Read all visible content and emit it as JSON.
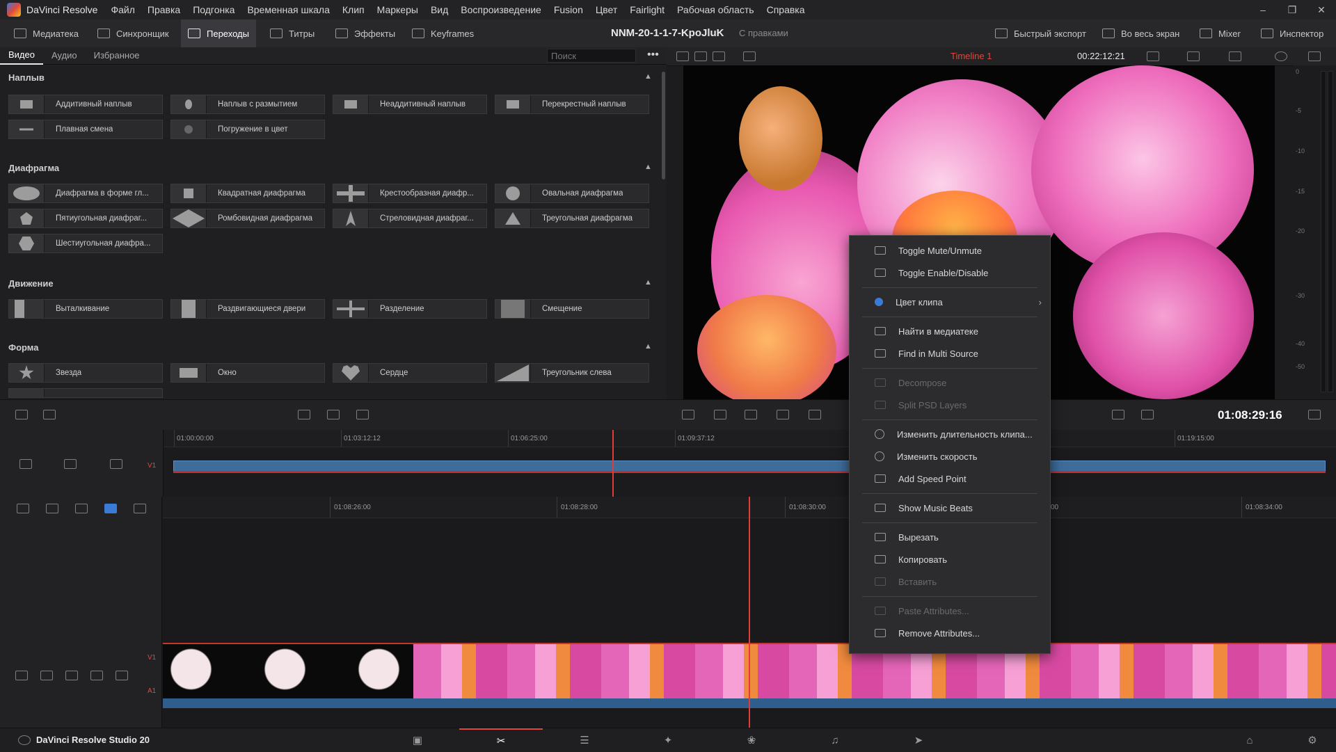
{
  "menubar": {
    "app": "DaVinci Resolve",
    "items": [
      "Файл",
      "Правка",
      "Подгонка",
      "Временная шкала",
      "Клип",
      "Маркеры",
      "Вид",
      "Воспроизведение",
      "Fusion",
      "Цвет",
      "Fairlight",
      "Рабочая область",
      "Справка"
    ]
  },
  "toolbar": {
    "media": "Медиатека",
    "sync": "Синхронщик",
    "transitions": "Переходы",
    "titles": "Титры",
    "effects": "Эффекты",
    "keyframes": "Keyframes",
    "project": "NNM-20-1-1-7-KpoJluK",
    "edited": "С правками",
    "quick_export": "Быстрый экспорт",
    "fullscreen": "Во весь экран",
    "mixer": "Mixer",
    "inspector": "Инспектор"
  },
  "fx_tabs": [
    "Видео",
    "Аудио",
    "Избранное"
  ],
  "fx_search_placeholder": "Поиск",
  "sections": {
    "dissolve": {
      "title": "Наплыв",
      "items": [
        "Аддитивный наплыв",
        "Наплыв с размытием",
        "Неаддитивный наплыв",
        "Перекрестный наплыв",
        "Плавная смена",
        "Погружение в цвет"
      ]
    },
    "iris": {
      "title": "Диафрагма",
      "items": [
        "Диафрагма в форме гл...",
        "Квадратная диафрагма",
        "Крестообразная диафр...",
        "Овальная диафрагма",
        "Пятиугольная диафраг...",
        "Ромбовидная диафрагма",
        "Стреловидная диафраг...",
        "Треугольная диафрагма",
        "Шестиугольная диафра..."
      ]
    },
    "motion": {
      "title": "Движение",
      "items": [
        "Выталкивание",
        "Раздвигающиеся двери",
        "Разделение",
        "Смещение"
      ]
    },
    "shape": {
      "title": "Форма",
      "items": [
        "Звезда",
        "Окно",
        "Сердце",
        "Треугольник слева"
      ]
    }
  },
  "viewer": {
    "timeline_name": "Timeline 1",
    "timecode": "00:22:12:21"
  },
  "meter_scale": [
    "0",
    "-5",
    "-10",
    "-15",
    "-20",
    "-30",
    "-40",
    "-50"
  ],
  "playhead_timecode": "01:08:29:16",
  "upper_ruler": [
    "01:00:00:00",
    "01:03:12:12",
    "01:06:25:00",
    "01:09:37:12",
    "01:19:15:00"
  ],
  "lower_ruler": [
    "01:08:26:00",
    "01:08:28:00",
    "01:08:30:00",
    "00",
    "01:08:34:00"
  ],
  "tracks": {
    "v1": "V1",
    "a1": "A1"
  },
  "context_menu": {
    "items": [
      {
        "label": "Toggle Mute/Unmute",
        "icon": "speaker-icon",
        "disabled": false
      },
      {
        "label": "Toggle Enable/Disable",
        "icon": "checkbox-icon",
        "disabled": false
      },
      {
        "label": "Цвет клипа",
        "icon": "color-dot-icon",
        "disabled": false
      },
      {
        "label": "Найти в медиатеке",
        "icon": "find-icon",
        "disabled": false
      },
      {
        "label": "Find in Multi Source",
        "icon": "find-multi-icon",
        "disabled": false
      },
      {
        "label": "Decompose",
        "icon": "decompose-icon",
        "disabled": true
      },
      {
        "label": "Split PSD Layers",
        "icon": "psd-icon",
        "disabled": true
      },
      {
        "label": "Изменить длительность клипа...",
        "icon": "duration-icon",
        "disabled": false
      },
      {
        "label": "Изменить скорость",
        "icon": "speed-icon",
        "disabled": false
      },
      {
        "label": "Add Speed Point",
        "icon": "speed-point-icon",
        "disabled": false
      },
      {
        "label": "Show Music Beats",
        "icon": "beats-icon",
        "disabled": false
      },
      {
        "label": "Вырезать",
        "icon": "cut-icon",
        "disabled": false
      },
      {
        "label": "Копировать",
        "icon": "copy-icon",
        "disabled": false
      },
      {
        "label": "Вставить",
        "icon": "paste-icon",
        "disabled": true
      },
      {
        "label": "Paste Attributes...",
        "icon": "paste-attr-icon",
        "disabled": true
      },
      {
        "label": "Remove Attributes...",
        "icon": "remove-attr-icon",
        "disabled": false
      }
    ]
  },
  "bottom": {
    "app_name": "DaVinci Resolve Studio 20"
  },
  "colors": {
    "accent_red": "#e0483e",
    "clip_blue": "#3e6d9c",
    "panel": "#1f1f22"
  }
}
